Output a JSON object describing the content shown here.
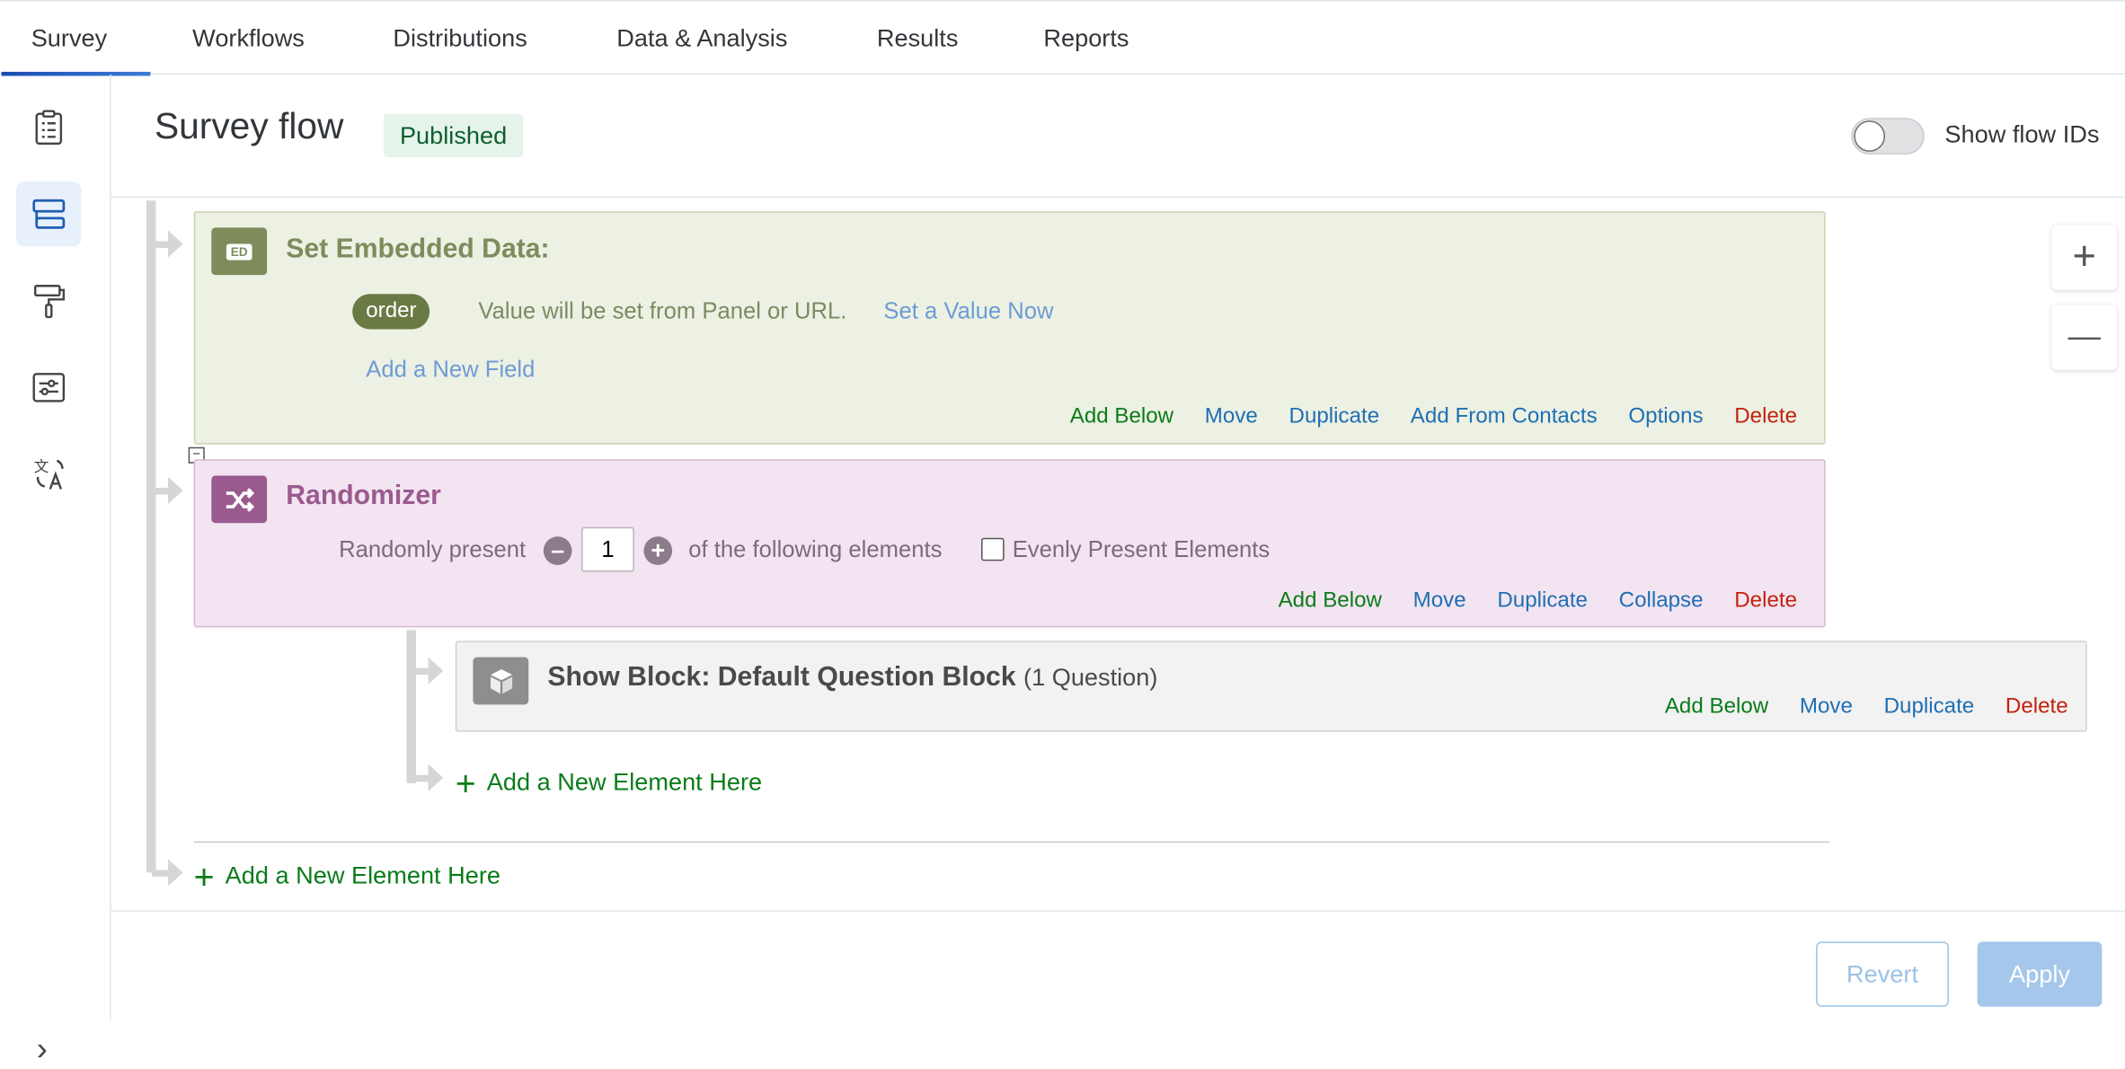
{
  "nav": {
    "tabs": [
      {
        "label": "Survey"
      },
      {
        "label": "Workflows"
      },
      {
        "label": "Distributions"
      },
      {
        "label": "Data & Analysis"
      },
      {
        "label": "Results"
      },
      {
        "label": "Reports"
      }
    ],
    "active_tab": "Survey"
  },
  "rail": {
    "items": [
      {
        "icon": "clipboard-icon"
      },
      {
        "icon": "survey-flow-icon",
        "active": true
      },
      {
        "icon": "paint-roller-icon"
      },
      {
        "icon": "survey-options-icon"
      },
      {
        "icon": "translate-icon"
      }
    ]
  },
  "header": {
    "title": "Survey flow",
    "status": "Published",
    "toggle_label": "Show flow IDs",
    "toggle_on": false
  },
  "embedded_data": {
    "title": "Set Embedded Data:",
    "icon_text": "ED",
    "field_name": "order",
    "field_hint": "Value will be set from Panel or URL.",
    "set_value_link": "Set a Value Now",
    "add_field_link": "Add a New Field",
    "actions": {
      "add_below": "Add Below",
      "move": "Move",
      "duplicate": "Duplicate",
      "add_from_contacts": "Add From Contacts",
      "options": "Options",
      "delete": "Delete"
    }
  },
  "randomizer": {
    "title": "Randomizer",
    "collapse_glyph": "−",
    "prefix": "Randomly present",
    "count": "1",
    "suffix": "of the following elements",
    "evenly_label": "Evenly Present Elements",
    "evenly_checked": false,
    "actions": {
      "add_below": "Add Below",
      "move": "Move",
      "duplicate": "Duplicate",
      "collapse": "Collapse",
      "delete": "Delete"
    }
  },
  "block": {
    "title": "Show Block: Default Question Block",
    "question_count": "(1 Question)",
    "actions": {
      "add_below": "Add Below",
      "move": "Move",
      "duplicate": "Duplicate",
      "delete": "Delete"
    }
  },
  "add_element_inner": "Add a New Element Here",
  "add_element_outer": "Add a New Element Here",
  "zoom": {
    "in": "+",
    "out": "—"
  },
  "footer": {
    "revert": "Revert",
    "apply": "Apply",
    "expand_glyph": "›"
  }
}
